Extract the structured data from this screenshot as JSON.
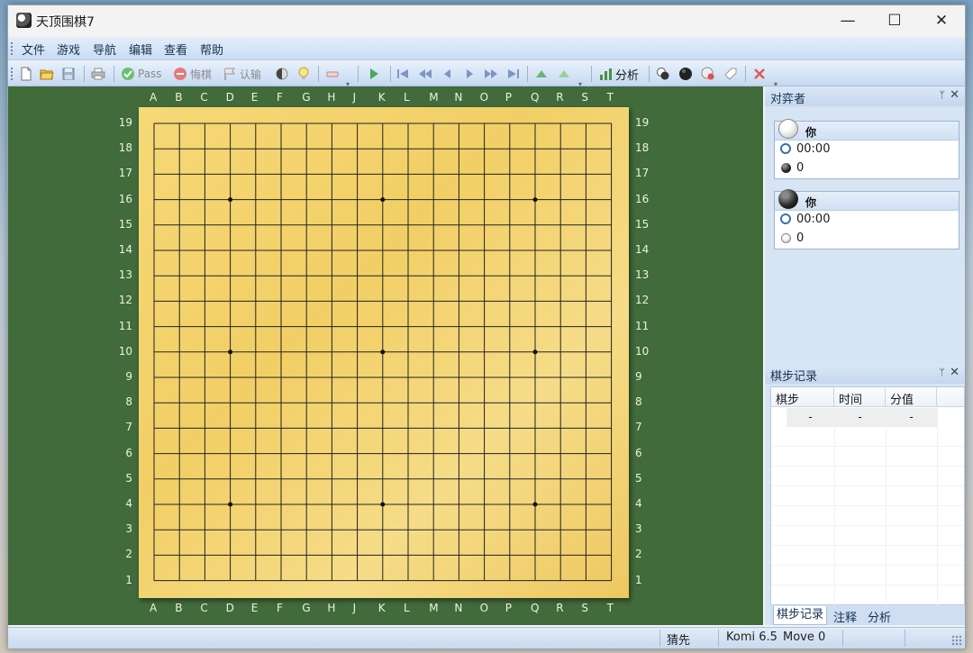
{
  "window": {
    "title": "天顶围棋7"
  },
  "controls": {
    "minimize": "—",
    "maximize": "☐",
    "close": "✕"
  },
  "menu": [
    "文件",
    "游戏",
    "导航",
    "编辑",
    "查看",
    "帮助"
  ],
  "toolbar": {
    "pass": "Pass",
    "undo": "悔棋",
    "resign": "认输",
    "analyze": "分析"
  },
  "board": {
    "size": 19,
    "columns": [
      "A",
      "B",
      "C",
      "D",
      "E",
      "F",
      "G",
      "H",
      "J",
      "K",
      "L",
      "M",
      "N",
      "O",
      "P",
      "Q",
      "R",
      "S",
      "T"
    ],
    "rows": [
      "19",
      "18",
      "17",
      "16",
      "15",
      "14",
      "13",
      "12",
      "11",
      "10",
      "9",
      "8",
      "7",
      "6",
      "5",
      "4",
      "3",
      "2",
      "1"
    ],
    "star_points": [
      "D16",
      "K16",
      "Q16",
      "D10",
      "K10",
      "Q10",
      "D4",
      "K4",
      "Q4"
    ]
  },
  "players_panel": {
    "title": "对弈者",
    "players": [
      {
        "name": "你",
        "stone": "white",
        "time": "00:00",
        "captures": "0"
      },
      {
        "name": "你",
        "stone": "black",
        "time": "00:00",
        "captures": "0"
      }
    ]
  },
  "records_panel": {
    "title": "棋步记录",
    "columns": [
      "棋步",
      "时间",
      "分值"
    ],
    "rows": [
      [
        "-",
        "-",
        "-"
      ]
    ]
  },
  "side_tabs": [
    "棋步记录",
    "注释",
    "分析"
  ],
  "status": {
    "mode": "猜先",
    "komi": "Komi 6.5",
    "move": "Move 0"
  }
}
